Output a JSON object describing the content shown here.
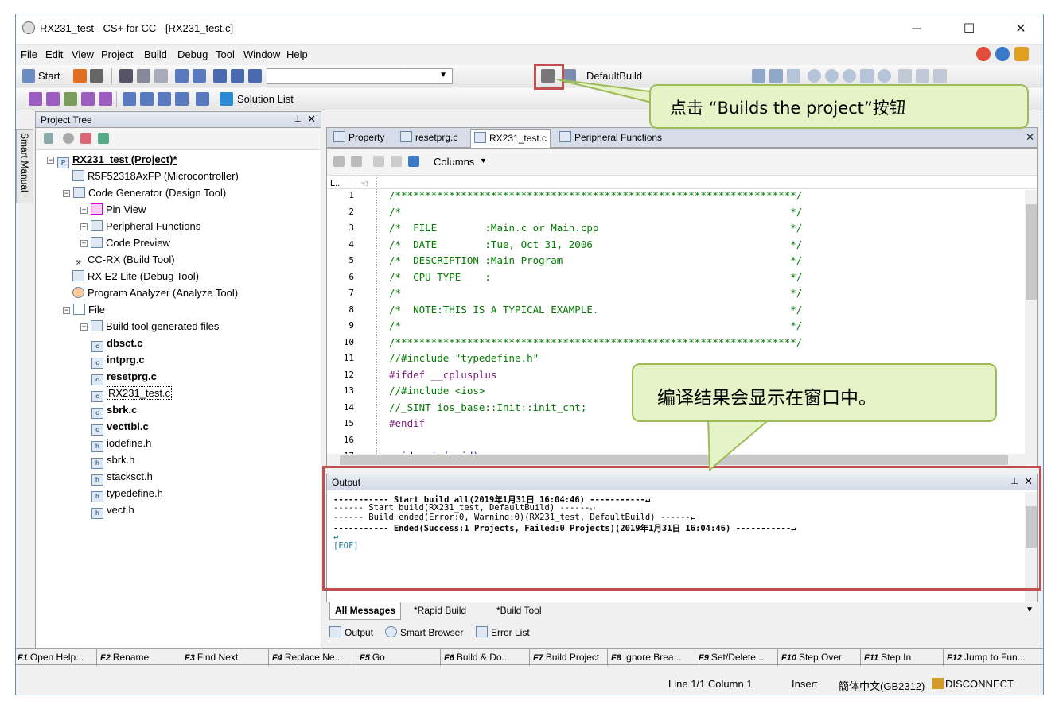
{
  "window": {
    "title": "RX231_test - CS+ for CC - [RX231_test.c]",
    "controls": {
      "minimize": "─",
      "maximize": "☐",
      "close": "✕"
    }
  },
  "menu": [
    "File",
    "Edit",
    "View",
    "Project",
    "Build",
    "Debug",
    "Tool",
    "Window",
    "Help"
  ],
  "toolbar": {
    "start_label": "Start",
    "build_config": "DefaultBuild",
    "solution_list_label": "Solution List"
  },
  "project_tree": {
    "title": "Project Tree",
    "side_tab": "Smart Manual",
    "items": [
      {
        "label": "RX231_test (Project)*",
        "bold": true
      },
      {
        "label": "R5F52318AxFP (Microcontroller)"
      },
      {
        "label": "Code Generator (Design Tool)"
      },
      {
        "label": "Pin View"
      },
      {
        "label": "Peripheral Functions"
      },
      {
        "label": "Code Preview"
      },
      {
        "label": "CC-RX (Build Tool)"
      },
      {
        "label": "RX E2 Lite (Debug Tool)"
      },
      {
        "label": "Program Analyzer (Analyze Tool)"
      },
      {
        "label": "File"
      },
      {
        "label": "Build tool generated files"
      },
      {
        "label": "dbsct.c",
        "bold": true
      },
      {
        "label": "intprg.c",
        "bold": true
      },
      {
        "label": "resetprg.c",
        "bold": true
      },
      {
        "label": "RX231_test.c"
      },
      {
        "label": "sbrk.c",
        "bold": true
      },
      {
        "label": "vecttbl.c",
        "bold": true
      },
      {
        "label": "iodefine.h"
      },
      {
        "label": "sbrk.h"
      },
      {
        "label": "stacksct.h"
      },
      {
        "label": "typedefine.h"
      },
      {
        "label": "vect.h"
      }
    ]
  },
  "editor": {
    "tabs": [
      "Property",
      "resetprg.c",
      "RX231_test.c",
      "Peripheral Functions"
    ],
    "columns_label": "Columns",
    "lines": [
      {
        "n": "1",
        "text": "/*******************************************************************/"
      },
      {
        "n": "2",
        "text": "/*                                                                 */"
      },
      {
        "n": "3",
        "text": "/*  FILE        :Main.c or Main.cpp                                */"
      },
      {
        "n": "4",
        "text": "/*  DATE        :Tue, Oct 31, 2006                                 */"
      },
      {
        "n": "5",
        "text": "/*  DESCRIPTION :Main Program                                      */"
      },
      {
        "n": "6",
        "text": "/*  CPU TYPE    :                                                  */"
      },
      {
        "n": "7",
        "text": "/*                                                                 */"
      },
      {
        "n": "8",
        "text": "/*  NOTE:THIS IS A TYPICAL EXAMPLE.                                */"
      },
      {
        "n": "9",
        "text": "/*                                                                 */"
      },
      {
        "n": "10",
        "text": "/*******************************************************************/"
      },
      {
        "n": "11",
        "text": "//#include \"typedefine.h\""
      },
      {
        "n": "12",
        "text": "#ifdef __cplusplus"
      },
      {
        "n": "13",
        "text": "//#include <ios>"
      },
      {
        "n": "14",
        "text": "//_SINT ios_base::Init::init_cnt;"
      },
      {
        "n": "15",
        "text": "#endif"
      },
      {
        "n": "16",
        "text": ""
      },
      {
        "n": "17",
        "text": "void main(void);"
      }
    ]
  },
  "output": {
    "title": "Output",
    "lines": [
      "----------- Start build all(2019年1月31日 16:04:46) -----------↵",
      "------ Start build(RX231_test, DefaultBuild) ------↵",
      "------ Build ended(Error:0, Warning:0)(RX231_test, DefaultBuild) ------↵",
      "----------- Ended(Success:1 Projects, Failed:0 Projects)(2019年1月31日 16:04:46) -----------↵",
      "↵",
      "[EOF]"
    ],
    "tabs": [
      "All Messages",
      "*Rapid Build",
      "*Build Tool"
    ],
    "bottom_tabs": [
      "Output",
      "Smart Browser",
      "Error List"
    ]
  },
  "fkeys": [
    {
      "key": "F1",
      "label": "Open Help..."
    },
    {
      "key": "F2",
      "label": "Rename"
    },
    {
      "key": "F3",
      "label": "Find Next"
    },
    {
      "key": "F4",
      "label": "Replace Ne..."
    },
    {
      "key": "F5",
      "label": "Go"
    },
    {
      "key": "F6",
      "label": "Build & Do..."
    },
    {
      "key": "F7",
      "label": "Build Project"
    },
    {
      "key": "F8",
      "label": "Ignore Brea..."
    },
    {
      "key": "F9",
      "label": "Set/Delete..."
    },
    {
      "key": "F10",
      "label": "Step Over"
    },
    {
      "key": "F11",
      "label": "Step In"
    },
    {
      "key": "F12",
      "label": "Jump to Fun..."
    }
  ],
  "status": {
    "position": "Line 1/1  Column 1",
    "mode": "Insert",
    "encoding": "簡体中文(GB2312)",
    "connection": "DISCONNECT"
  },
  "callouts": {
    "build_button": "点击 “Builds the project”按钮",
    "output_window": "编译结果会显示在窗口中。"
  },
  "colors": {
    "highlight_box": "#c0504d",
    "callout_fill": "#e6f3c7",
    "callout_border": "#9bbb59"
  }
}
